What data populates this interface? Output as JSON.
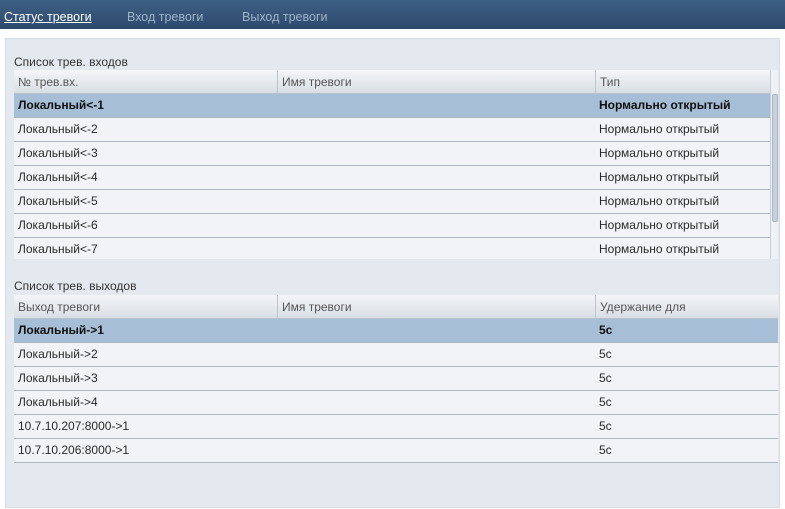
{
  "tabs": [
    {
      "label": "Статус тревоги",
      "active": true
    },
    {
      "label": "Вход тревоги",
      "active": false
    },
    {
      "label": "Выход тревоги",
      "active": false
    }
  ],
  "inputs": {
    "title": "Список трев. входов",
    "columns": [
      "№ трев.вх.",
      "Имя тревоги",
      "Тип"
    ],
    "rows": [
      {
        "id": "Локальный<-1",
        "name": "",
        "type": "Нормально открытый",
        "selected": true
      },
      {
        "id": "Локальный<-2",
        "name": "",
        "type": "Нормально открытый",
        "selected": false
      },
      {
        "id": "Локальный<-3",
        "name": "",
        "type": "Нормально открытый",
        "selected": false
      },
      {
        "id": "Локальный<-4",
        "name": "",
        "type": "Нормально открытый",
        "selected": false
      },
      {
        "id": "Локальный<-5",
        "name": "",
        "type": "Нормально открытый",
        "selected": false
      },
      {
        "id": "Локальный<-6",
        "name": "",
        "type": "Нормально открытый",
        "selected": false
      },
      {
        "id": "Локальный<-7",
        "name": "",
        "type": "Нормально открытый",
        "selected": false
      }
    ]
  },
  "outputs": {
    "title": "Список трев. выходов",
    "columns": [
      "Выход тревоги",
      "Имя тревоги",
      "Удержание для"
    ],
    "rows": [
      {
        "id": "Локальный->1",
        "name": "",
        "hold": "5c",
        "selected": true
      },
      {
        "id": "Локальный->2",
        "name": "",
        "hold": "5c",
        "selected": false
      },
      {
        "id": "Локальный->3",
        "name": "",
        "hold": "5c",
        "selected": false
      },
      {
        "id": "Локальный->4",
        "name": "",
        "hold": "5c",
        "selected": false
      },
      {
        "id": "10.7.10.207:8000->1",
        "name": "",
        "hold": "5c",
        "selected": false
      },
      {
        "id": "10.7.10.206:8000->1",
        "name": "",
        "hold": "5c",
        "selected": false
      }
    ]
  },
  "colors": {
    "tabbar": "#34547a",
    "panel": "#e4e9ef",
    "selected_row": "#a6bfd6"
  }
}
